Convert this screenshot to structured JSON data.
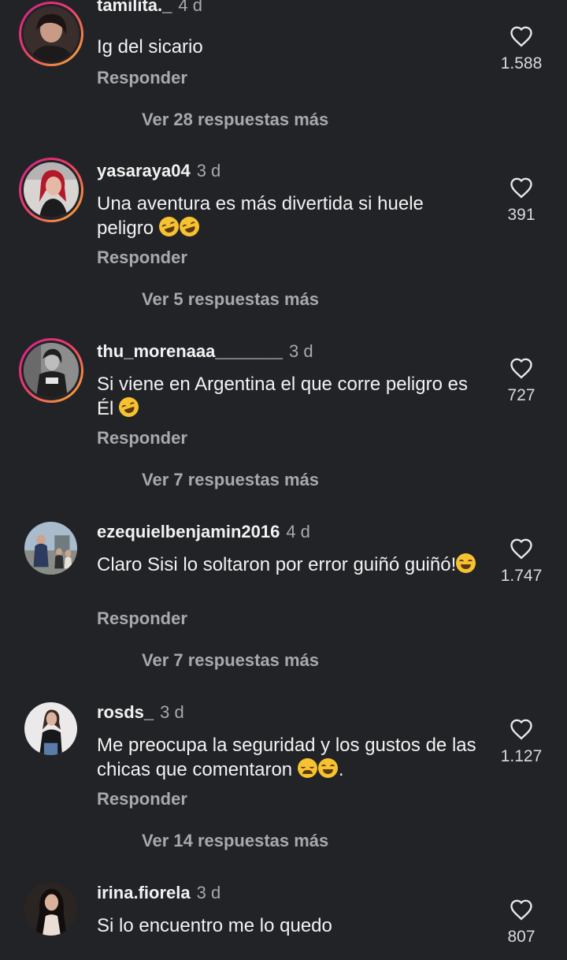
{
  "comments": [
    {
      "username": "tamilita._",
      "time": "4 d",
      "text": "Ig del sicario",
      "emojis": [],
      "reply_label": "Responder",
      "likes": "1.588",
      "more_replies": "Ver 28 respuestas más"
    },
    {
      "username": "yasaraya04",
      "time": "3 d",
      "text": "Una aventura es más divertida si huele peligro",
      "emojis": [
        "rolling-on-floor-laughing",
        "rolling-on-floor-laughing"
      ],
      "reply_label": "Responder",
      "likes": "391",
      "more_replies": "Ver 5 respuestas más"
    },
    {
      "username": "thu_morenaaa_______",
      "time": "3 d",
      "text": "Si viene en Argentina el que corre peligro es Él",
      "emojis": [
        "rolling-on-floor-laughing"
      ],
      "reply_label": "Responder",
      "likes": "727",
      "more_replies": "Ver 7 respuestas más"
    },
    {
      "username": "ezequielbenjamin2016",
      "time": "4 d",
      "text": "Claro Sisi lo soltaron por error guiñó guiñó!",
      "emojis": [
        "grinning-sweat"
      ],
      "reply_label": "Responder",
      "likes": "1.747",
      "more_replies": "Ver 7 respuestas más"
    },
    {
      "username": "rosds_",
      "time": "3 d",
      "text": "Me preocupa la seguridad y los gustos de las chicas que comentaron",
      "emojis": [
        "weary-face",
        "grinning-sweat"
      ],
      "text_suffix": ".",
      "reply_label": "Responder",
      "likes": "1.127",
      "more_replies": "Ver 14 respuestas más"
    },
    {
      "username": "irina.fiorela",
      "time": "3 d",
      "text": "Si lo encuentro me lo quedo",
      "emojis": [],
      "reply_label": "",
      "likes": "807",
      "more_replies": ""
    }
  ],
  "icons": {
    "like": "heart-outline-icon"
  },
  "colors": {
    "background": "#222327",
    "primary_text": "#f2f2f2",
    "secondary_text": "#a8a8ad",
    "story_ring_start": "#d2208a",
    "story_ring_end": "#f7b52b"
  }
}
